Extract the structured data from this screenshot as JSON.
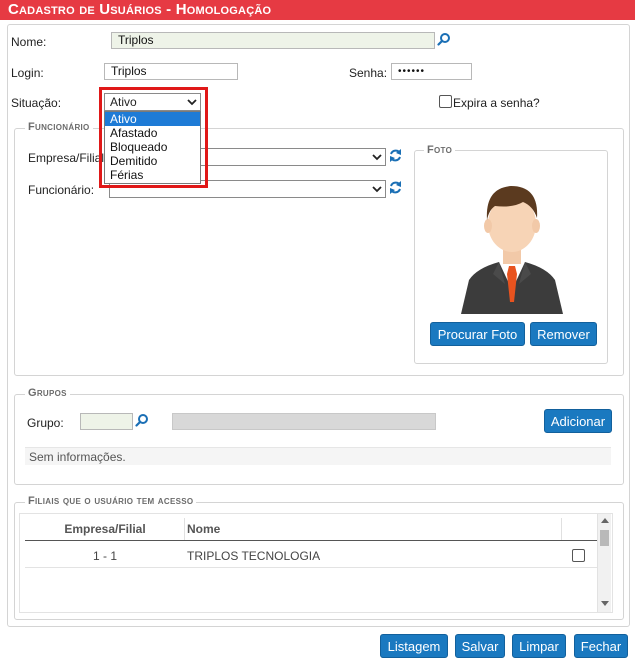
{
  "window": {
    "title": "Cadastro de Usuários  - Homologação"
  },
  "form": {
    "nome_label": "Nome:",
    "nome_value": "Triplos",
    "login_label": "Login:",
    "login_value": "Triplos",
    "senha_label": "Senha:",
    "senha_value": "••••••",
    "situacao_label": "Situação:",
    "situacao_value": "Ativo",
    "situacao_options": [
      "Ativo",
      "Afastado",
      "Bloqueado",
      "Demitido",
      "Férias"
    ],
    "expira_label": "Expira a senha?"
  },
  "funcionario": {
    "legend": "Funcionário",
    "empresa_label": "Empresa/Filial",
    "funcionario_label": "Funcionário:"
  },
  "foto": {
    "legend": "Foto",
    "procurar_button": "Procurar Foto",
    "remover_button": "Remover"
  },
  "grupos": {
    "legend": "Grupos",
    "grupo_label": "Grupo:",
    "adicionar_button": "Adicionar",
    "empty_text": "Sem informações."
  },
  "filiais": {
    "legend": "Filiais que o usuário tem acesso",
    "columns": [
      "Empresa/Filial",
      "Nome"
    ],
    "rows": [
      {
        "empresa": "1 - 1",
        "nome": "TRIPLOS TECNOLOGIA"
      }
    ]
  },
  "footer": {
    "listagem": "Listagem",
    "salvar": "Salvar",
    "limpar": "Limpar",
    "fechar": "Fechar"
  },
  "colors": {
    "title_bar": "#e63a43",
    "button": "#1a79c0",
    "highlight": "#e01818"
  }
}
